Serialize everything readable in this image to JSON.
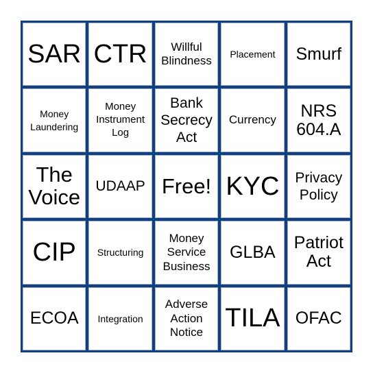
{
  "board": {
    "border_color": "#13407c",
    "cells": [
      {
        "text": "SAR"
      },
      {
        "text": "CTR"
      },
      {
        "text": "Willful\nBlindness"
      },
      {
        "text": "Placement"
      },
      {
        "text": "Smurf"
      },
      {
        "text": "Money\nLaundering"
      },
      {
        "text": "Money\nInstrument\nLog"
      },
      {
        "text": "Bank\nSecrecy\nAct"
      },
      {
        "text": "Currency"
      },
      {
        "text": "NRS\n604.A"
      },
      {
        "text": "The\nVoice"
      },
      {
        "text": "UDAAP"
      },
      {
        "text": "Free!"
      },
      {
        "text": "KYC"
      },
      {
        "text": "Privacy\nPolicy"
      },
      {
        "text": "CIP"
      },
      {
        "text": "Structuring"
      },
      {
        "text": "Money\nService\nBusiness"
      },
      {
        "text": "GLBA"
      },
      {
        "text": "Patriot\nAct"
      },
      {
        "text": "ECOA"
      },
      {
        "text": "Integration"
      },
      {
        "text": "Adverse\nAction\nNotice"
      },
      {
        "text": "TILA"
      },
      {
        "text": "OFAC"
      }
    ]
  }
}
